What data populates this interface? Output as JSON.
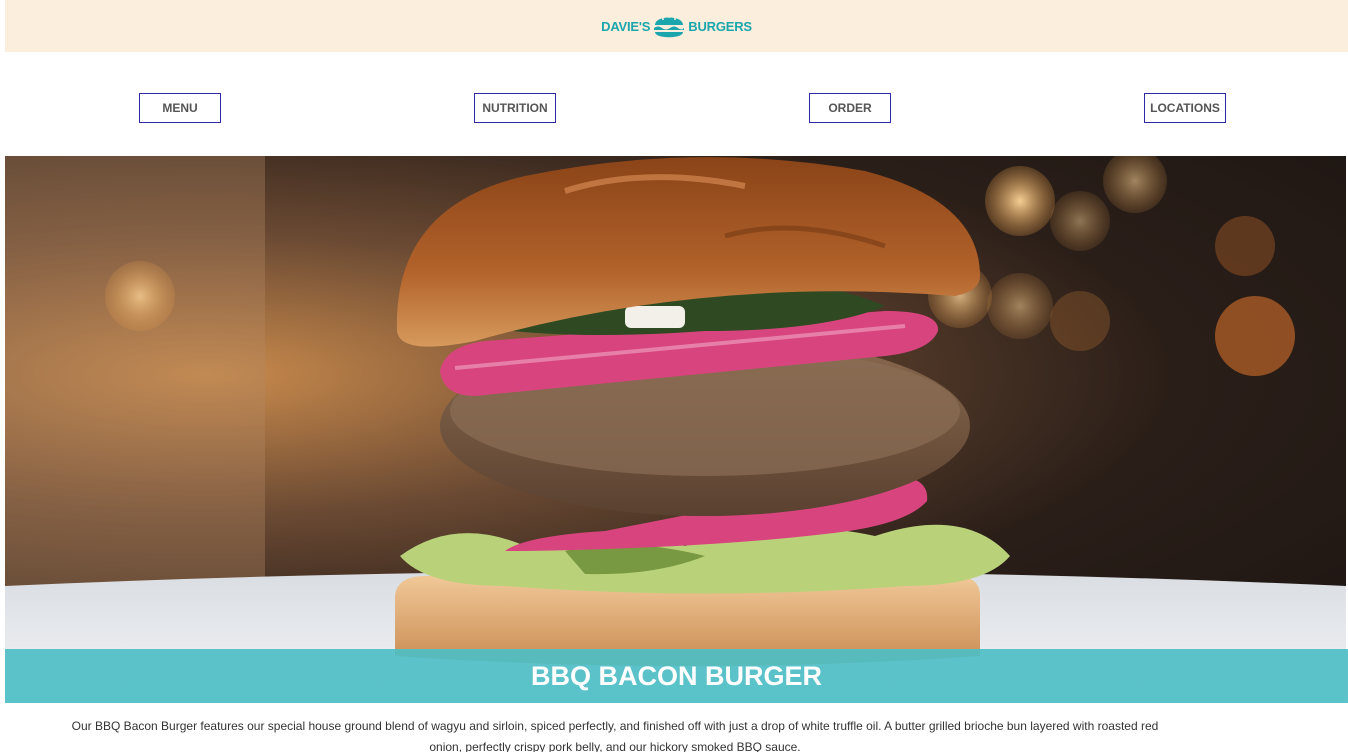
{
  "header": {
    "logo_left": "DAVIE'S",
    "logo_right": "BURGERS",
    "logo_icon": "burger-icon",
    "background_color": "#fbeedd",
    "brand_color": "#1ba6ad"
  },
  "nav": {
    "items": [
      {
        "label": "MENU"
      },
      {
        "label": "NUTRITION"
      },
      {
        "label": "ORDER"
      },
      {
        "label": "LOCATIONS"
      }
    ],
    "border_color": "#2d2aa3"
  },
  "hero": {
    "title": "BBQ BACON BURGER",
    "band_color": "#4dbec4"
  },
  "description": "Our BBQ Bacon Burger features our special house ground blend of wagyu and sirloin, spiced perfectly, and finished off with just a drop of white truffle oil. A butter grilled brioche bun layered with roasted red onion, perfectly crispy pork belly, and our hickory smoked BBQ sauce."
}
